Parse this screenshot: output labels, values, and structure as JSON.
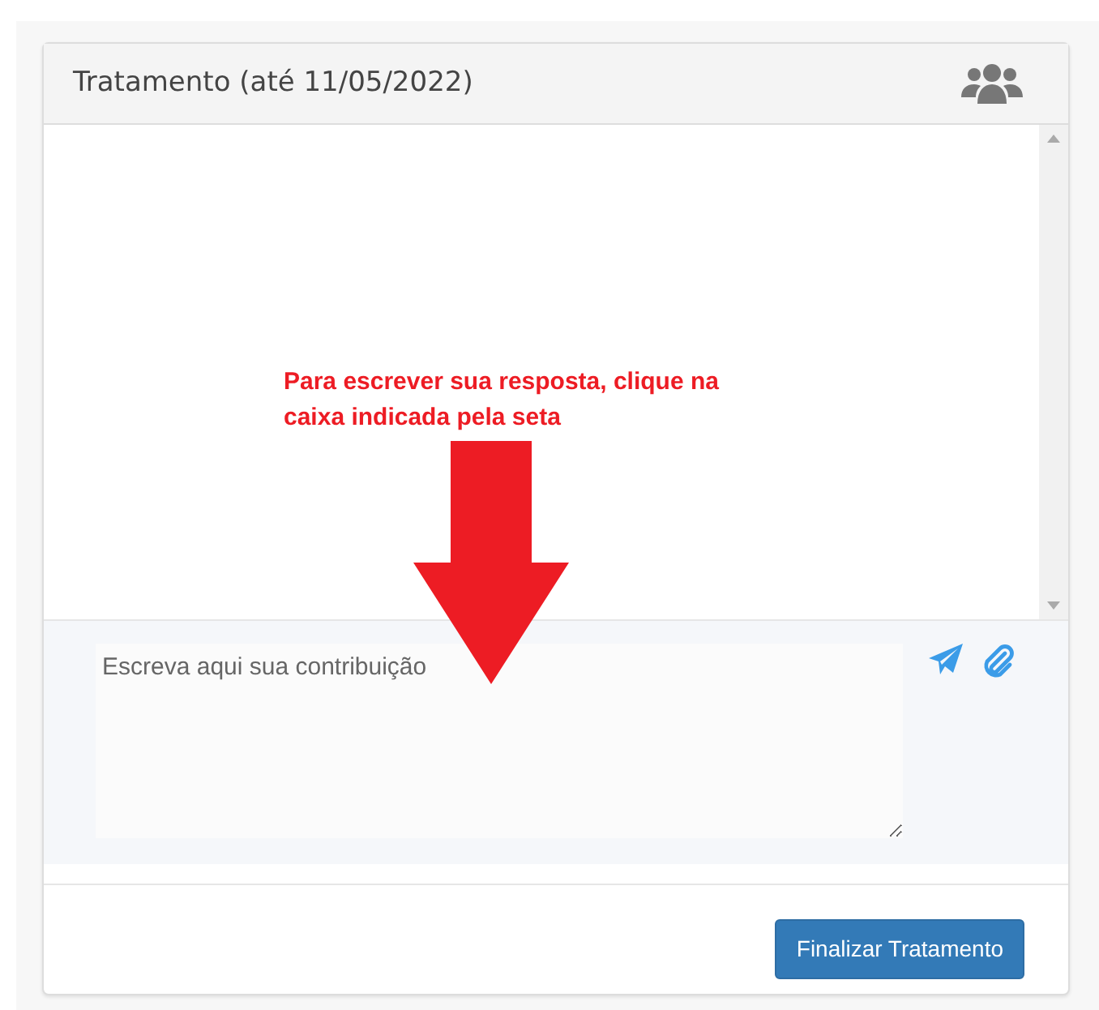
{
  "card": {
    "title": "Tratamento (até 11/05/2022)"
  },
  "annotation": {
    "text": "Para escrever sua resposta, clique na caixa indicada pela seta"
  },
  "compose": {
    "placeholder": "Escreva aqui sua contribuição"
  },
  "footer": {
    "button": "Finalizar Tratamento"
  }
}
